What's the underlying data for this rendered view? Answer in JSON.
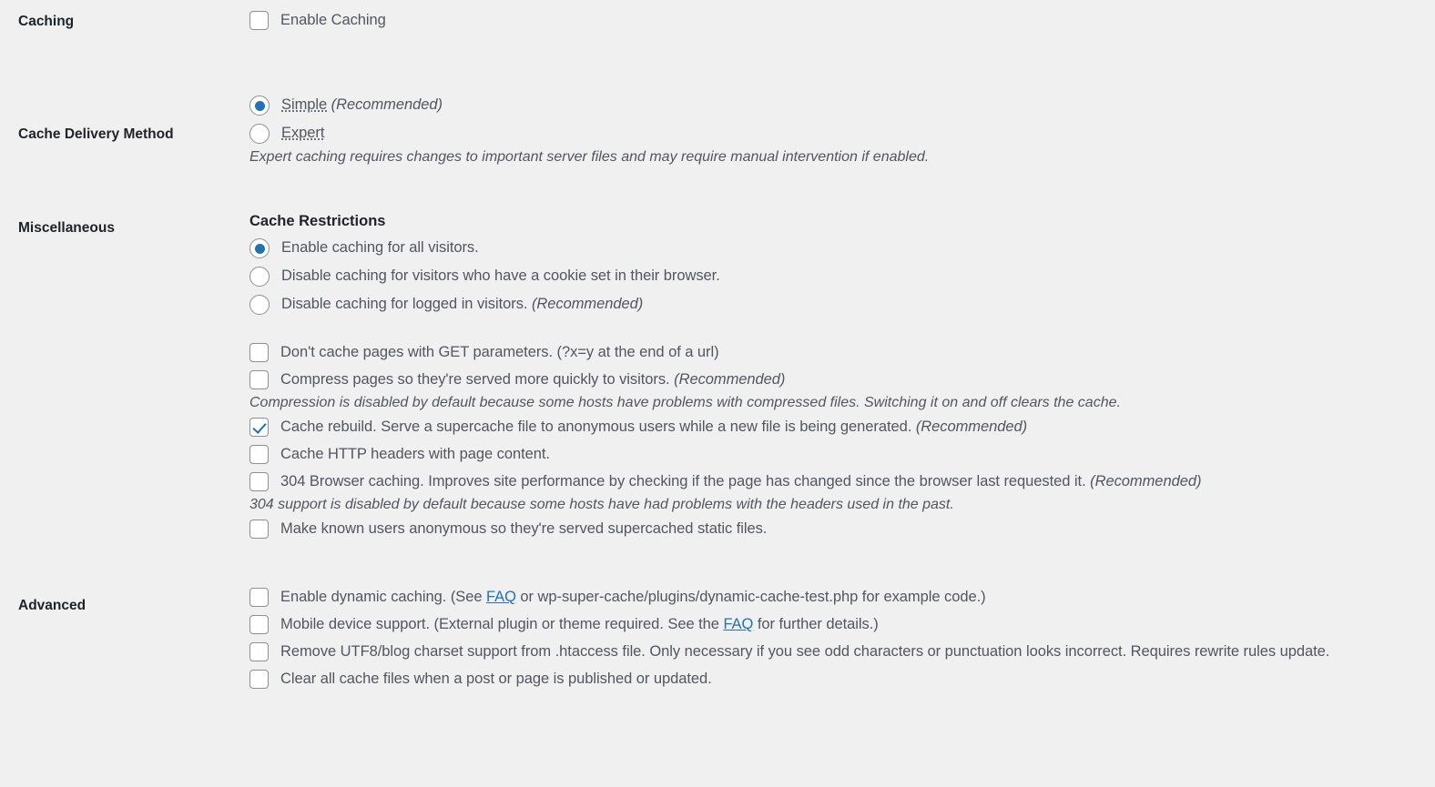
{
  "rows": {
    "caching": {
      "label": "Caching",
      "enable_caching": {
        "text": "Enable Caching",
        "checked": false
      }
    },
    "delivery": {
      "label": "Cache Delivery Method",
      "options": [
        {
          "name": "Simple",
          "suffix": " (Recommended)",
          "selected": true
        },
        {
          "name": "Expert",
          "suffix": "",
          "selected": false
        }
      ],
      "note": "Expert caching requires changes to important server files and may require manual intervention if enabled."
    },
    "miscellaneous": {
      "label": "Miscellaneous",
      "restrictions_heading": "Cache Restrictions",
      "restrictions": [
        {
          "text": "Enable caching for all visitors.",
          "suffix": "",
          "selected": true
        },
        {
          "text": "Disable caching for visitors who have a cookie set in their browser.",
          "suffix": "",
          "selected": false
        },
        {
          "text": "Disable caching for logged in visitors.",
          "suffix": " (Recommended)",
          "selected": false
        }
      ],
      "checkboxes": [
        {
          "text": "Don't cache pages with GET parameters. (?x=y at the end of a url)",
          "suffix": "",
          "checked": false
        },
        {
          "text": "Compress pages so they're served more quickly to visitors.",
          "suffix": " (Recommended)",
          "checked": false
        }
      ],
      "compression_note": "Compression is disabled by default because some hosts have problems with compressed files. Switching it on and off clears the cache.",
      "checkboxes2": [
        {
          "text": "Cache rebuild. Serve a supercache file to anonymous users while a new file is being generated.",
          "suffix": " (Recommended)",
          "checked": true
        },
        {
          "text": "Cache HTTP headers with page content.",
          "suffix": "",
          "checked": false
        },
        {
          "text": "304 Browser caching. Improves site performance by checking if the page has changed since the browser last requested it.",
          "suffix": " (Recommended)",
          "checked": false
        }
      ],
      "browser_note": "304 support is disabled by default because some hosts have had problems with the headers used in the past.",
      "checkboxes3": [
        {
          "text": "Make known users anonymous so they're served supercached static files.",
          "suffix": "",
          "checked": false
        }
      ]
    },
    "advanced": {
      "label": "Advanced",
      "dynamic_caching": {
        "pre": "Enable dynamic caching. (See ",
        "link": "FAQ",
        "post": " or wp-super-cache/plugins/dynamic-cache-test.php for example code.)",
        "checked": false
      },
      "mobile_support": {
        "pre": "Mobile device support. (External plugin or theme required. See the ",
        "link": "FAQ",
        "post": " for further details.)",
        "checked": false
      },
      "items": [
        {
          "text": "Remove UTF8/blog charset support from .htaccess file. Only necessary if you see odd characters or punctuation looks incorrect. Requires rewrite rules update.",
          "checked": false
        },
        {
          "text": "Clear all cache files when a post or page is published or updated.",
          "checked": false
        }
      ]
    }
  },
  "colors": {
    "background": "#f0f0f1",
    "accent": "#2271b1",
    "label_text": "#1d2327",
    "body_text": "#50575e",
    "control_border": "#8c8f94"
  }
}
